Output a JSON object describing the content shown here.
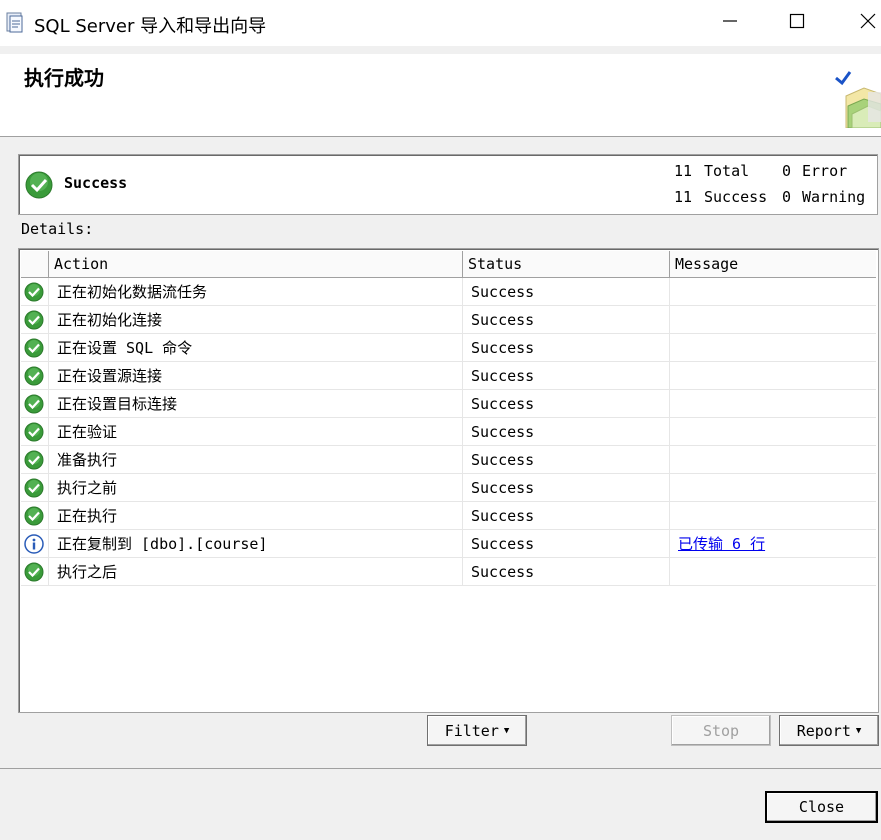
{
  "window": {
    "title": "SQL Server 导入和导出向导",
    "controls": {
      "minimize": "minimize",
      "maximize": "maximize",
      "close": "close"
    }
  },
  "header": {
    "title": "执行成功",
    "icon": "wizard-success-icon"
  },
  "summary": {
    "status": "Success",
    "total_count": "11",
    "total_label": "Total",
    "error_count": "0",
    "error_label": "Error",
    "success_count": "11",
    "success_label": "Success",
    "warning_count": "0",
    "warning_label": "Warning"
  },
  "details_label": "Details:",
  "table": {
    "columns": [
      "Action",
      "Status",
      "Message"
    ],
    "rows": [
      {
        "icon": "success",
        "action": "正在初始化数据流任务",
        "status": "Success",
        "message": ""
      },
      {
        "icon": "success",
        "action": "正在初始化连接",
        "status": "Success",
        "message": ""
      },
      {
        "icon": "success",
        "action": "正在设置 SQL 命令",
        "status": "Success",
        "message": ""
      },
      {
        "icon": "success",
        "action": "正在设置源连接",
        "status": "Success",
        "message": ""
      },
      {
        "icon": "success",
        "action": "正在设置目标连接",
        "status": "Success",
        "message": ""
      },
      {
        "icon": "success",
        "action": "正在验证",
        "status": "Success",
        "message": ""
      },
      {
        "icon": "success",
        "action": "准备执行",
        "status": "Success",
        "message": ""
      },
      {
        "icon": "success",
        "action": "执行之前",
        "status": "Success",
        "message": ""
      },
      {
        "icon": "success",
        "action": "正在执行",
        "status": "Success",
        "message": ""
      },
      {
        "icon": "info",
        "action": "正在复制到 [dbo].[course]",
        "status": "Success",
        "message": "已传输 6 行"
      },
      {
        "icon": "success",
        "action": "执行之后",
        "status": "Success",
        "message": ""
      }
    ]
  },
  "buttons": {
    "filter": "Filter",
    "stop": "Stop",
    "report": "Report",
    "close": "Close"
  },
  "colors": {
    "success_green": "#3a9b3a",
    "info_blue": "#2a5cb8",
    "link": "#0000ee"
  }
}
